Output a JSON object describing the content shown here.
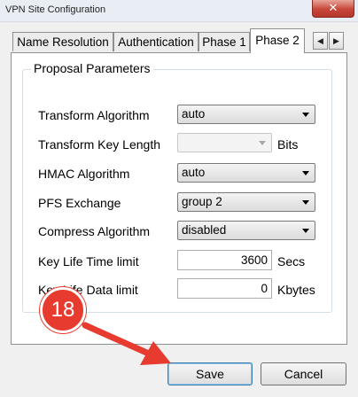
{
  "window": {
    "title": "VPN Site Configuration",
    "close_glyph": "✕"
  },
  "tabs": [
    {
      "label": "Name Resolution",
      "active": false
    },
    {
      "label": "Authentication",
      "active": false
    },
    {
      "label": "Phase 1",
      "active": false
    },
    {
      "label": "Phase 2",
      "active": true
    }
  ],
  "tab_scroll": {
    "left_glyph": "◀",
    "right_glyph": "▶"
  },
  "group": {
    "title": "Proposal Parameters"
  },
  "fields": {
    "transform_algorithm": {
      "label": "Transform Algorithm",
      "value": "auto"
    },
    "transform_key_length": {
      "label": "Transform Key Length",
      "value": "",
      "unit": "Bits",
      "enabled": false
    },
    "hmac_algorithm": {
      "label": "HMAC Algorithm",
      "value": "auto"
    },
    "pfs_exchange": {
      "label": "PFS Exchange",
      "value": "group 2"
    },
    "compress_algorithm": {
      "label": "Compress Algorithm",
      "value": "disabled"
    },
    "key_life_time": {
      "label": "Key Life Time limit",
      "value": "3600",
      "unit": "Secs"
    },
    "key_life_data": {
      "label": "Key Life Data limit",
      "value": "0",
      "unit": "Kbytes"
    }
  },
  "buttons": {
    "save": "Save",
    "cancel": "Cancel"
  },
  "annotation": {
    "step_number": "18",
    "color": "#e63b2e"
  }
}
